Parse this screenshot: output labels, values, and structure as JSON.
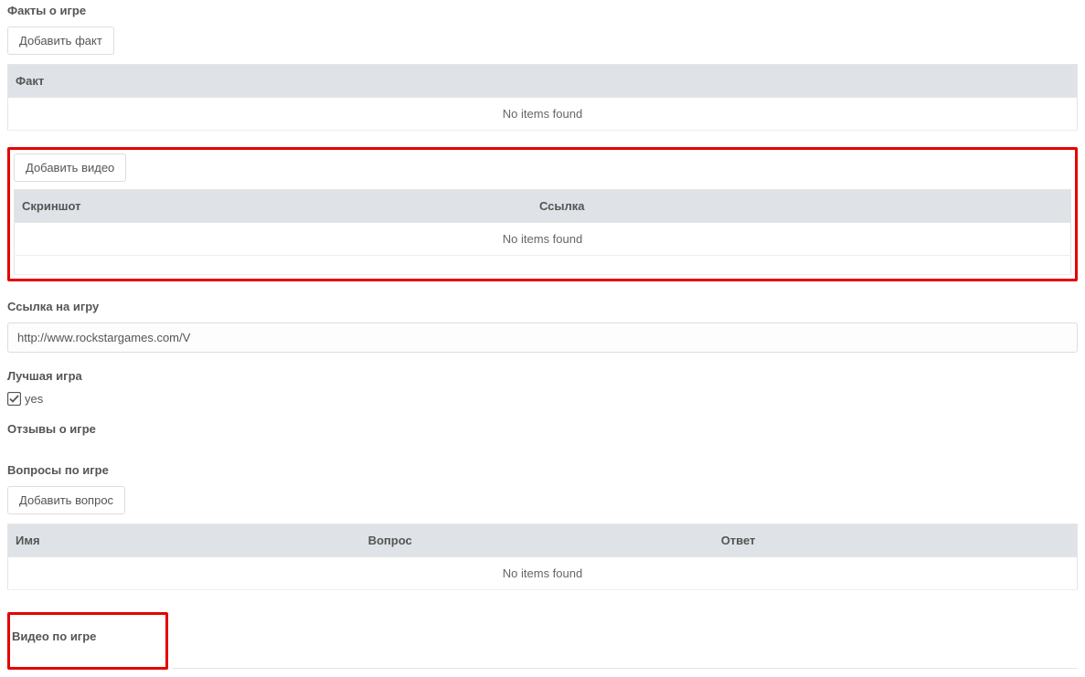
{
  "facts": {
    "heading": "Факты о игре",
    "add_button": "Добавить факт",
    "columns": {
      "fact": "Факт"
    },
    "no_items": "No items found"
  },
  "videos_embed": {
    "add_button": "Добавить видео",
    "columns": {
      "screenshot": "Скриншот",
      "link": "Ссылка"
    },
    "no_items": "No items found"
  },
  "game_link": {
    "heading": "Ссылка на игру",
    "value": "http://www.rockstargames.com/V"
  },
  "best_game": {
    "heading": "Лучшая игра",
    "checkbox_label": "yes",
    "checked": true
  },
  "reviews": {
    "heading": "Отзывы о игре"
  },
  "questions": {
    "heading": "Вопросы по игре",
    "add_button": "Добавить вопрос",
    "columns": {
      "name": "Имя",
      "question": "Вопрос",
      "answer": "Ответ"
    },
    "no_items": "No items found"
  },
  "game_video": {
    "heading": "Видео по игре"
  }
}
